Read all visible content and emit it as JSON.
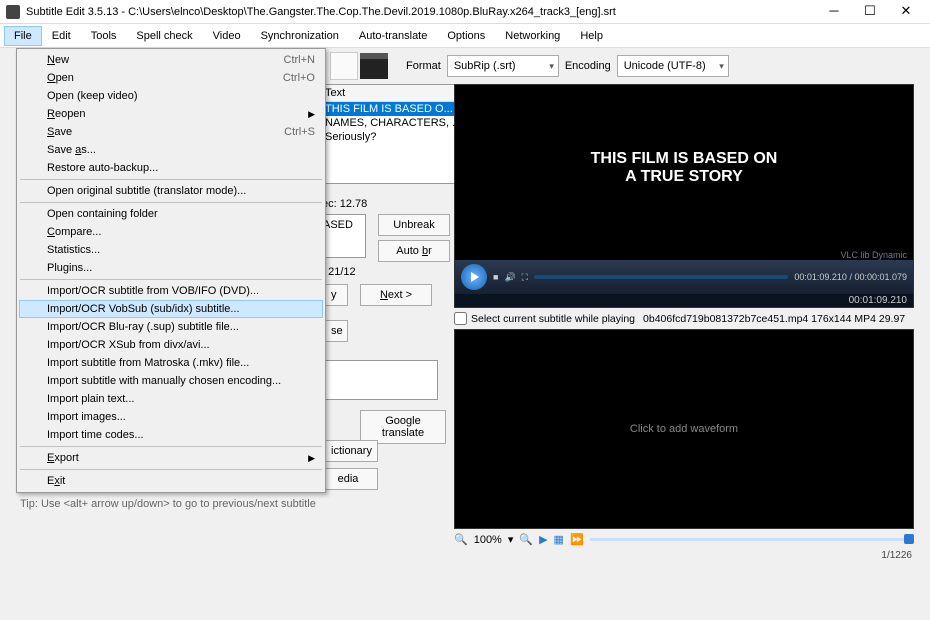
{
  "title": "Subtitle Edit 3.5.13 - C:\\Users\\elnco\\Desktop\\The.Gangster.The.Cop.The.Devil.2019.1080p.BluRay.x264_track3_[eng].srt",
  "menubar": [
    "File",
    "Edit",
    "Tools",
    "Spell check",
    "Video",
    "Synchronization",
    "Auto-translate",
    "Options",
    "Networking",
    "Help"
  ],
  "fileMenu": {
    "items": [
      {
        "label": "New",
        "shortcut": "Ctrl+N",
        "u": 0
      },
      {
        "label": "Open",
        "shortcut": "Ctrl+O",
        "u": 0
      },
      {
        "label": "Open (keep video)"
      },
      {
        "label": "Reopen",
        "sub": true,
        "u": 0
      },
      {
        "label": "Save",
        "shortcut": "Ctrl+S",
        "u": 0
      },
      {
        "label": "Save as...",
        "u": 5
      },
      {
        "label": "Restore auto-backup..."
      },
      {
        "sep": true
      },
      {
        "label": "Open original subtitle (translator mode)..."
      },
      {
        "sep": true
      },
      {
        "label": "Open containing folder"
      },
      {
        "label": "Compare...",
        "u": 0
      },
      {
        "label": "Statistics..."
      },
      {
        "label": "Plugins..."
      },
      {
        "sep": true
      },
      {
        "label": "Import/OCR subtitle from VOB/IFO (DVD)..."
      },
      {
        "label": "Import/OCR VobSub (sub/idx) subtitle...",
        "hl": true
      },
      {
        "label": "Import/OCR Blu-ray (.sup) subtitle file..."
      },
      {
        "label": "Import/OCR XSub from divx/avi..."
      },
      {
        "label": "Import subtitle from Matroska (.mkv) file..."
      },
      {
        "label": "Import subtitle with manually chosen encoding..."
      },
      {
        "label": "Import plain text..."
      },
      {
        "label": "Import images..."
      },
      {
        "label": "Import time codes..."
      },
      {
        "sep": true
      },
      {
        "label": "Export",
        "sub": true,
        "u": 0
      },
      {
        "sep": true
      },
      {
        "label": "Exit",
        "u": 1
      }
    ]
  },
  "toolbar": {
    "format_label": "Format",
    "format_value": "SubRip (.srt)",
    "encoding_label": "Encoding",
    "encoding_value": "Unicode (UTF-8)"
  },
  "list": {
    "head": "Text",
    "rows": [
      "THIS FILM IS BASED O...",
      "NAMES, CHARACTERS, ...",
      "Seriously?"
    ]
  },
  "peek": {
    "ec": "ec: 12.78",
    "ased": "ASED",
    "chars": ": 21/12",
    "y": "y",
    "se": "se",
    "ictionary": "ictionary",
    "edia": "edia"
  },
  "btns": {
    "unbreak": "Unbreak",
    "autobr": "Auto br",
    "next": "Next >",
    "gtrans": "Google translate"
  },
  "video": {
    "line1": "THIS FILM IS BASED ON",
    "line2": "A TRUE STORY",
    "wm": "VLC lib Dynamic",
    "t1": "00:01:09.210 / 00:00:01.079",
    "t2": "00:01:09.210"
  },
  "chk": {
    "label": "Select current subtitle while playing",
    "info": "0b406fcd719b081372b7ce451.mp4 176x144 MP4 29.97"
  },
  "wave": "Click to add waveform",
  "zoom": "100%",
  "tip": "Tip: Use <alt+ arrow up/down> to go to previous/next subtitle",
  "pager": "1/1226"
}
